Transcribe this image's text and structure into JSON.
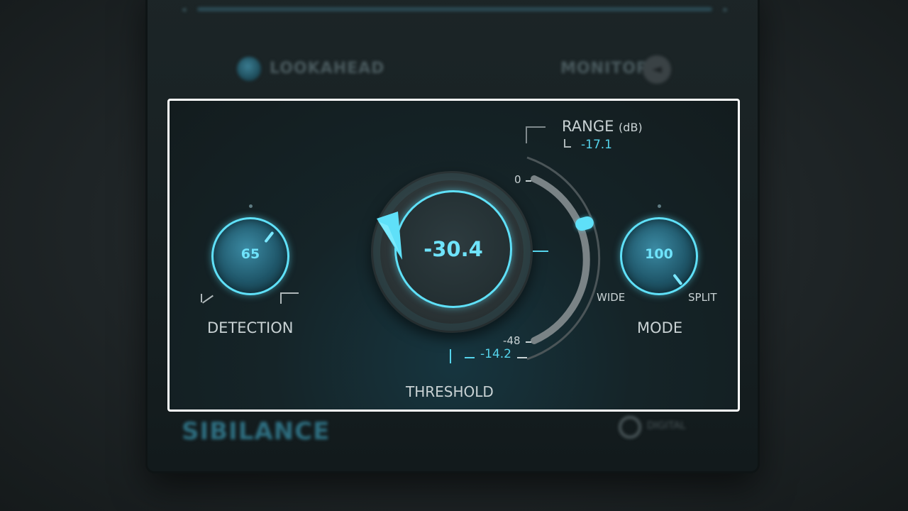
{
  "background": {
    "lookahead_label": "LOOKAHEAD",
    "monitor_label": "MONITOR",
    "logo_text": "SIBILANCE",
    "brand_text": "DIGITAL"
  },
  "detection": {
    "value": "65",
    "label": "DETECTION"
  },
  "threshold": {
    "value": "-30.4",
    "label": "THRESHOLD",
    "scale_top": "0",
    "scale_bottom": "-48",
    "gr_readout": "-14.2"
  },
  "range": {
    "label": "RANGE",
    "unit": "(dB)",
    "value": "-17.1"
  },
  "mode": {
    "value": "100",
    "label": "MODE",
    "left_label": "WIDE",
    "right_label": "SPLIT"
  },
  "colors": {
    "accent": "#55d4ec",
    "focus_border": "#ffffff",
    "panel_bg": "#152428"
  },
  "icons": {
    "monitor": "speaker-icon",
    "detection_left": "step-down-icon",
    "detection_right": "step-up-icon"
  }
}
